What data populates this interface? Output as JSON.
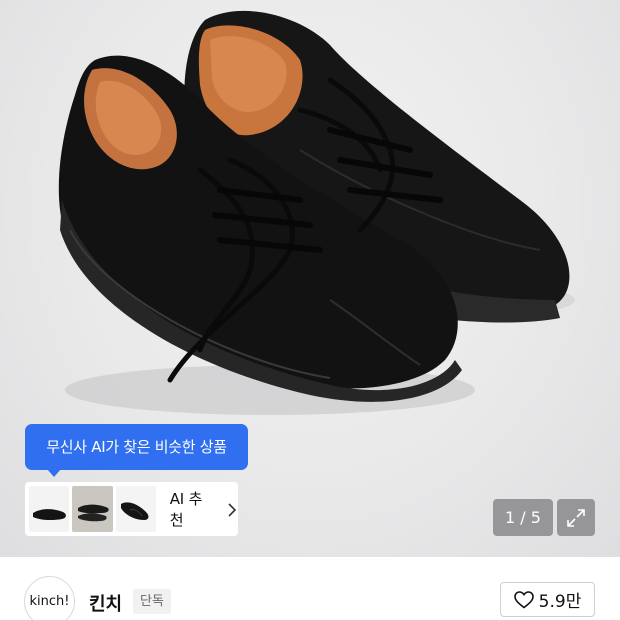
{
  "product_image": {
    "pagination": "1 / 5"
  },
  "ai_recommend": {
    "tooltip": "무신사 AI가 찾은 비슷한 상품",
    "label": "AI 추천",
    "thumbnails": [
      "shoe-thumbnail-1",
      "shoe-thumbnail-2",
      "shoe-thumbnail-3"
    ]
  },
  "brand": {
    "logo_text": "kinch!",
    "name": "킨치",
    "badge": "단독"
  },
  "like": {
    "count": "5.9만"
  },
  "colors": {
    "accent_blue": "#2f6ff0",
    "shoe_black": "#141414",
    "lining_orange": "#c97a45"
  },
  "icons": [
    "chevron-right-icon",
    "expand-icon",
    "heart-icon"
  ]
}
